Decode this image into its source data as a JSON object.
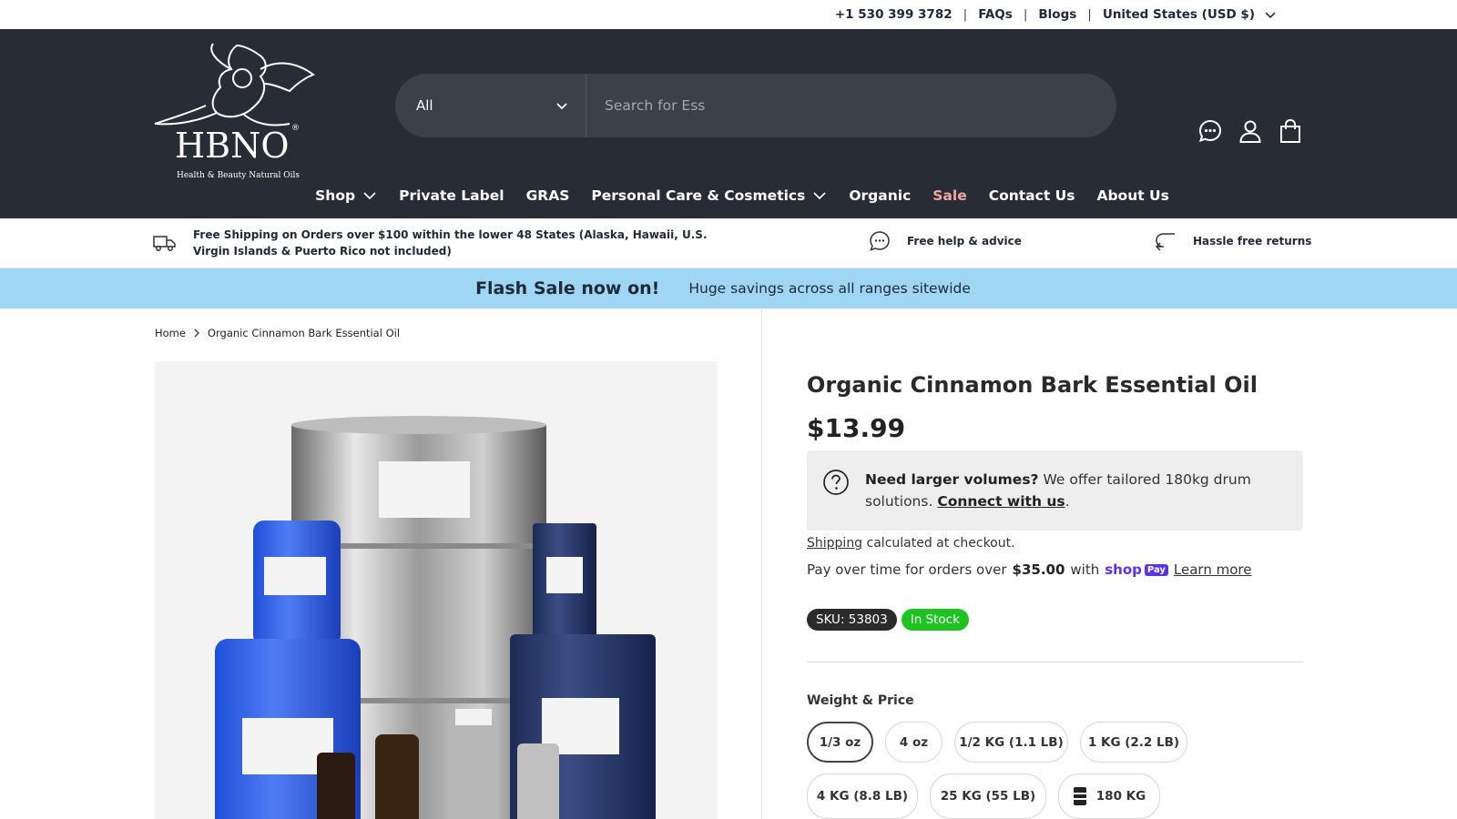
{
  "topbar": {
    "phone": "+1 530 399 3782",
    "faqs": "FAQs",
    "blogs": "Blogs",
    "currency": "United States (USD $)"
  },
  "header": {
    "logo_text": "HBNO",
    "logo_tagline": "Health & Beauty Natural Oils",
    "search": {
      "category": "All",
      "placeholder": "Search for Ess"
    },
    "icons": [
      "chat-icon",
      "account-icon",
      "bag-icon"
    ]
  },
  "nav": {
    "items": [
      {
        "label": "Shop",
        "dropdown": true
      },
      {
        "label": "Private Label"
      },
      {
        "label": "GRAS"
      },
      {
        "label": "Personal Care & Cosmetics",
        "dropdown": true
      },
      {
        "label": "Organic"
      },
      {
        "label": "Sale"
      },
      {
        "label": "Contact Us"
      },
      {
        "label": "About Us"
      }
    ],
    "sale_color": "#f3a7a3"
  },
  "benefits": {
    "shipping": "Free Shipping on Orders over $100 within the lower 48 States (Alaska, Hawaii, U.S. Virgin Islands & Puerto Rico not included)",
    "help": "Free help & advice",
    "returns": "Hassle free returns"
  },
  "flash": {
    "headline": "Flash Sale now on!",
    "subtext": "Huge savings across all ranges sitewide",
    "bg_color": "#9ed6f3"
  },
  "breadcrumb": {
    "home": "Home",
    "current": "Organic Cinnamon Bark Essential Oil"
  },
  "product": {
    "title": "Organic Cinnamon Bark Essential Oil",
    "price": "$13.99",
    "bulk": {
      "bold": "Need larger volumes?",
      "text": " We offer tailored 180kg drum solutions. ",
      "link": "Connect with us",
      "end": "."
    },
    "shipping_link": "Shipping",
    "shipping_text": " calculated at checkout.",
    "pay": {
      "prefix": "Pay over time for orders over",
      "amount": "$35.00",
      "with": "with",
      "brand": "shop",
      "brand_box": "Pay",
      "learn": "Learn more"
    },
    "sku": "SKU: 53803",
    "stock": "In Stock",
    "stock_color": "#1fc31f",
    "weight_label": "Weight & Price",
    "options": [
      "1/3 oz",
      "4 oz",
      "1/2 KG (1.1 LB)",
      "1 KG (2.2 LB)",
      "4 KG (8.8 LB)",
      "25 KG (55 LB)",
      "180 KG"
    ],
    "selected_option": "1/3 oz"
  }
}
